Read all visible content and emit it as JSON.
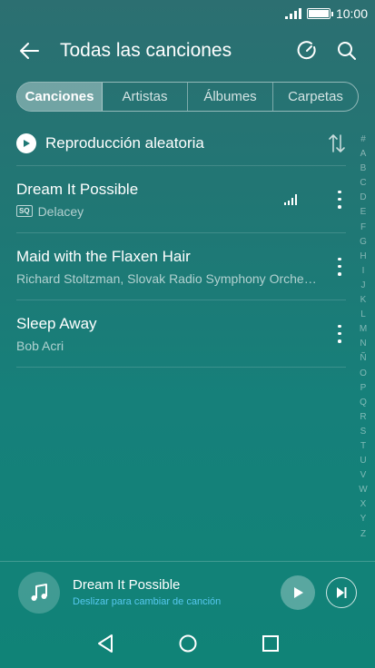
{
  "status": {
    "time": "10:00"
  },
  "header": {
    "title": "Todas las canciones",
    "back_icon": "arrow-left-icon",
    "actions": [
      "sleep-timer-icon",
      "search-icon"
    ]
  },
  "tabs": [
    {
      "label": "Canciones",
      "active": true
    },
    {
      "label": "Artistas",
      "active": false
    },
    {
      "label": "Álbumes",
      "active": false
    },
    {
      "label": "Carpetas",
      "active": false
    }
  ],
  "shuffle": {
    "label": "Reproducción aleatoria"
  },
  "songs": [
    {
      "title": "Dream It Possible",
      "badge": "SQ",
      "artist": "Delacey",
      "playing": true
    },
    {
      "title": "Maid with the Flaxen Hair",
      "artist": "Richard Stoltzman, Slovak Radio Symphony Orche…",
      "playing": false
    },
    {
      "title": "Sleep Away",
      "artist": "Bob Acri",
      "playing": false
    }
  ],
  "alphabet": [
    "#",
    "A",
    "B",
    "C",
    "D",
    "E",
    "F",
    "G",
    "H",
    "I",
    "J",
    "K",
    "L",
    "M",
    "N",
    "Ñ",
    "O",
    "P",
    "Q",
    "R",
    "S",
    "T",
    "U",
    "V",
    "W",
    "X",
    "Y",
    "Z"
  ],
  "now_playing": {
    "title": "Dream It Possible",
    "hint": "Deslizar para cambiar de canción"
  },
  "colors": {
    "hint": "#57c8f0"
  }
}
